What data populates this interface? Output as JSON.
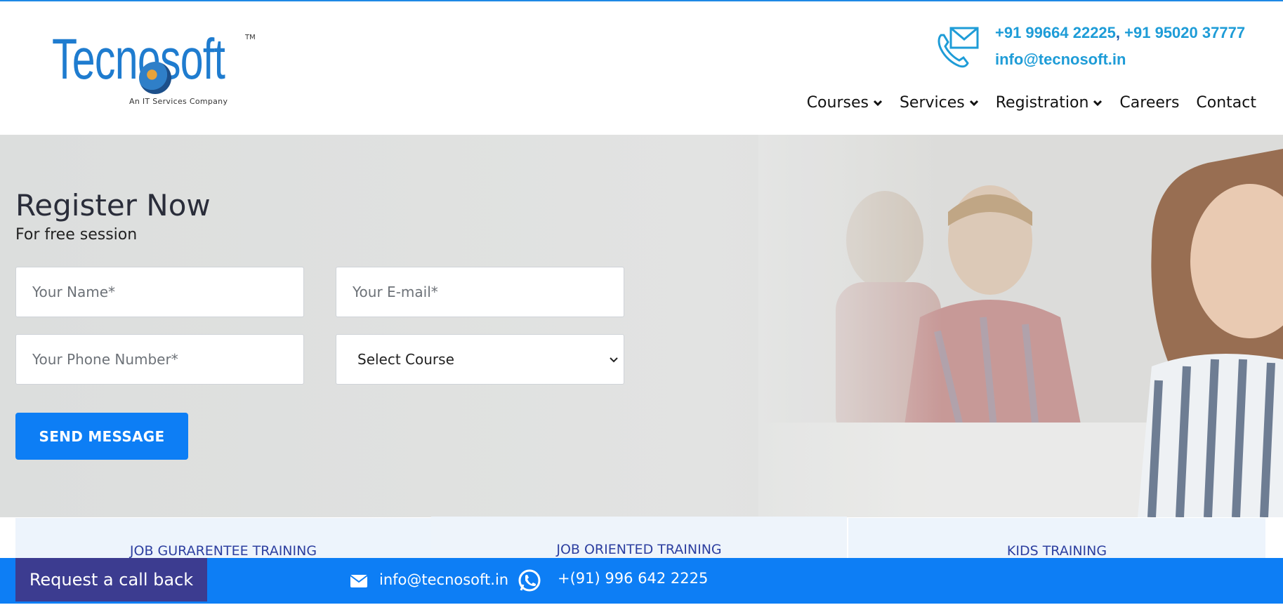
{
  "header": {
    "logo_text": "Tecnosoft",
    "logo_tm": "TM",
    "logo_tagline": "An IT Services Company",
    "phone_1": "+91 99664 22225",
    "phone_separator": ",",
    "phone_2": "+91 95020 37777",
    "email": "info@tecnosoft.in",
    "contact_icon": "envelope-phone-icon"
  },
  "nav": {
    "items": [
      {
        "label": "Courses",
        "has_dropdown": true
      },
      {
        "label": "Services",
        "has_dropdown": true
      },
      {
        "label": "Registration",
        "has_dropdown": true
      },
      {
        "label": "Careers",
        "has_dropdown": false
      },
      {
        "label": "Contact",
        "has_dropdown": false
      }
    ]
  },
  "hero": {
    "title": "Register Now",
    "subtitle": "For free session"
  },
  "form": {
    "name_placeholder": "Your Name*",
    "email_placeholder": "Your E-mail*",
    "phone_placeholder": "Your Phone Number*",
    "course_select_value": "Select Course",
    "submit_label": "SEND MESSAGE"
  },
  "cards": [
    {
      "label": "JOB GURARENTEE TRAINING"
    },
    {
      "label": "JOB ORIENTED TRAINING"
    },
    {
      "label": "KIDS TRAINING"
    }
  ],
  "bottom_bar": {
    "callback_label": "Request a call back",
    "email": "info@tecnosoft.in",
    "phone": "+(91) 996 642 2225",
    "email_icon": "envelope-icon",
    "whatsapp_icon": "whatsapp-icon"
  },
  "colors": {
    "brand_blue": "#0d7ef5",
    "link_blue": "#1e9cd7",
    "callback_purple": "#3c3c90",
    "card_bg": "#edf4fc",
    "card_text": "#2d3fa0"
  }
}
